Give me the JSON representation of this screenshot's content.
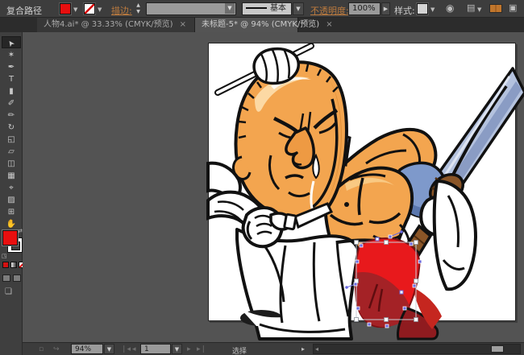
{
  "control_panel": {
    "object_label": "复合路径",
    "stroke_label": "描边:",
    "brush_value": "基本",
    "opacity_label": "不透明度:",
    "opacity_value": "100%",
    "style_label": "样式:"
  },
  "tabs": [
    {
      "label": "人物4.ai* @ 33.33% (CMYK/预览)",
      "close": "×"
    },
    {
      "label": "未标题-5* @ 94% (CMYK/预览)",
      "close": "×"
    }
  ],
  "tools": [
    {
      "name": "selection",
      "glyph": "➤"
    },
    {
      "name": "magic-wand",
      "glyph": "✶"
    },
    {
      "name": "pen",
      "glyph": "✒"
    },
    {
      "name": "type",
      "glyph": "T"
    },
    {
      "name": "rectangle",
      "glyph": "▮"
    },
    {
      "name": "paintbrush",
      "glyph": "✐"
    },
    {
      "name": "pencil",
      "glyph": "✏"
    },
    {
      "name": "rotate",
      "glyph": "↻"
    },
    {
      "name": "scale",
      "glyph": "◱"
    },
    {
      "name": "width",
      "glyph": "▱"
    },
    {
      "name": "free-transform",
      "glyph": "◫"
    },
    {
      "name": "mesh",
      "glyph": "▦"
    },
    {
      "name": "eyedropper",
      "glyph": "⌖"
    },
    {
      "name": "symbol-sprayer",
      "glyph": "▨"
    },
    {
      "name": "artboard",
      "glyph": "⊞"
    },
    {
      "name": "hand",
      "glyph": "✋"
    }
  ],
  "status_bar": {
    "zoom_value": "94%",
    "artboard_value": "1",
    "status_text": "选择"
  },
  "colors": {
    "fill_swatch": "#e80f0f",
    "label_accent": "#bd7b3e",
    "skin": "#f3a54f",
    "blade_blue": "#b4c2de",
    "shoulder_blue": "#7e99cb",
    "garment_red": "#e8191c",
    "garment_dark_red": "#a42226"
  }
}
